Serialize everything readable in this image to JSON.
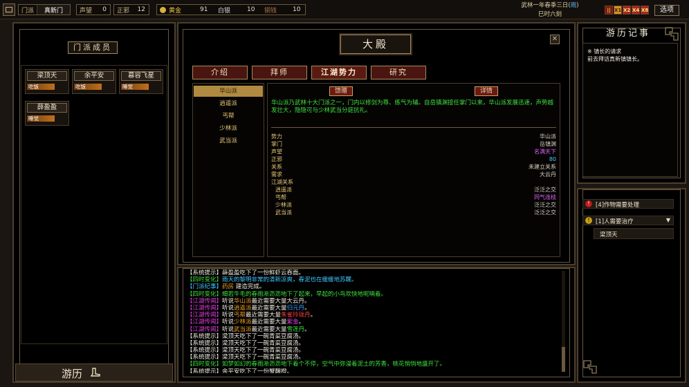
{
  "topbar": {
    "sect_label": "门派",
    "sect_name": "真新门",
    "reputation_label": "声望",
    "reputation_value": "0",
    "alignment_label": "正邪",
    "alignment_value": "12",
    "gold_label": "黄金",
    "gold_value": "91",
    "silver_label": "白银",
    "silver_value": "10",
    "copper_label": "铜钱",
    "copper_value": "10",
    "date_line1": "武林一年春季三日",
    "weather": "雨",
    "date_line2": "巳时六刻",
    "speeds": [
      "||",
      "X1",
      "X2",
      "X4",
      "X8"
    ],
    "options_label": "选项"
  },
  "members_panel": {
    "title": "门派成员",
    "members": [
      {
        "name": "梁顶天",
        "status": "吃饭"
      },
      {
        "name": "余平安",
        "status": "吃饭"
      },
      {
        "name": "慕容飞星",
        "status": "睡觉"
      },
      {
        "name": "薛盈盈",
        "status": "睡觉"
      }
    ],
    "travel_label": "游历"
  },
  "main": {
    "title": "大殿",
    "tabs": [
      "介绍",
      "拜师",
      "江湖势力",
      "研究"
    ],
    "active_tab": 2,
    "sects": [
      "华山派",
      "逍遥派",
      "丐帮",
      "少林派",
      "武当派"
    ],
    "active_sect": 0,
    "gift_label": "馈赠",
    "detail_label": "详情",
    "description": "华山派乃武林十大门派之一，门内以修剑为尊、练气为辅。自岳镇渊接任掌门以来，华山派发展迅速，声势越发壮大，隐隐可与少林武当分庭抗礼。",
    "info": [
      {
        "key": "势力",
        "value": "华山派"
      },
      {
        "key": "掌门",
        "value": "岳镇渊"
      },
      {
        "key": "声望",
        "value": "名满天下",
        "color": "#e060ff"
      },
      {
        "key": "正邪",
        "value": "80",
        "color": "#50c8ff"
      },
      {
        "key": "关系",
        "value": "未建立关系"
      },
      {
        "key": "需求",
        "value": "大云丹"
      },
      {
        "key": "江湖关系",
        "value": ""
      }
    ],
    "relations": [
      {
        "key": "逍遥派",
        "value": "泛泛之交"
      },
      {
        "key": "丐帮",
        "value": "同气连枝",
        "color": "#e060ff"
      },
      {
        "key": "少林派",
        "value": "泛泛之交"
      },
      {
        "key": "武当派",
        "value": "泛泛之交"
      }
    ]
  },
  "log": [
    {
      "tag": "【系统提示】",
      "tag_color": "#f0ebe0",
      "parts": [
        {
          "t": "薛盈盈吃下了一份鲜虾云吞面。"
        }
      ]
    },
    {
      "tag": "【四时变化】",
      "tag_color": "#40e040",
      "parts": [
        {
          "t": "雨天的黎明非常的清新凉爽，春泥也在缓缓地苏醒。",
          "c": "#40c8ff"
        }
      ]
    },
    {
      "tag": "【门派纪事】",
      "tag_color": "#40c8ff",
      "parts": [
        {
          "t": "药房",
          "c": "#f0a020"
        },
        {
          "t": " 建造完成。"
        }
      ]
    },
    {
      "tag": "【四时变化】",
      "tag_color": "#40e040",
      "parts": [
        {
          "t": "细若牛毛的春雨淅沥沥地下了起来，早起的小鸟欢快地呢喃着。",
          "c": "#40e040"
        }
      ]
    },
    {
      "tag": "【江湖传闻】",
      "tag_color": "#e040e0",
      "parts": [
        {
          "t": "听说"
        },
        {
          "t": "华山派",
          "c": "#f0a020"
        },
        {
          "t": "最近需要大量大云丹。"
        }
      ]
    },
    {
      "tag": "【江湖传闻】",
      "tag_color": "#e040e0",
      "parts": [
        {
          "t": "听说"
        },
        {
          "t": "逍遥派",
          "c": "#f0a020"
        },
        {
          "t": "最近需要大量"
        },
        {
          "t": "归元丹",
          "c": "#40a0ff"
        },
        {
          "t": "。"
        }
      ]
    },
    {
      "tag": "【江湖传闻】",
      "tag_color": "#e040e0",
      "parts": [
        {
          "t": "听说"
        },
        {
          "t": "丐帮",
          "c": "#f0a020"
        },
        {
          "t": "最近需要大量"
        },
        {
          "t": "朱雀玲珑丹",
          "c": "#ff4040"
        },
        {
          "t": "。"
        }
      ]
    },
    {
      "tag": "【江湖传闻】",
      "tag_color": "#e040e0",
      "parts": [
        {
          "t": "听说"
        },
        {
          "t": "少林派",
          "c": "#f0a020"
        },
        {
          "t": "最近需要大量"
        },
        {
          "t": "紫金",
          "c": "#e040e0"
        },
        {
          "t": "。"
        }
      ]
    },
    {
      "tag": "【江湖传闻】",
      "tag_color": "#e040e0",
      "parts": [
        {
          "t": "听说"
        },
        {
          "t": "武当派",
          "c": "#f0a020"
        },
        {
          "t": "最近需要大量"
        },
        {
          "t": "雪莲丹",
          "c": "#40e040"
        },
        {
          "t": "。"
        }
      ]
    },
    {
      "tag": "【系统提示】",
      "tag_color": "#f0ebe0",
      "parts": [
        {
          "t": "梁顶天吃下了一碗青菜豆腐汤。"
        }
      ]
    },
    {
      "tag": "【系统提示】",
      "tag_color": "#f0ebe0",
      "parts": [
        {
          "t": "梁顶天吃下了一碗青菜豆腐汤。"
        }
      ]
    },
    {
      "tag": "【系统提示】",
      "tag_color": "#f0ebe0",
      "parts": [
        {
          "t": "梁顶天吃下了一碗青菜豆腐汤。"
        }
      ]
    },
    {
      "tag": "【系统提示】",
      "tag_color": "#f0ebe0",
      "parts": [
        {
          "t": "梁顶天吃下了一碗青菜豆腐汤。"
        }
      ]
    },
    {
      "tag": "【四时变化】",
      "tag_color": "#40e040",
      "parts": [
        {
          "t": "如梦如幻的春雨淅沥沥地下着个不停，空气中弥漫着泥土的芳香，桃花悄悄地盛开了。",
          "c": "#40e040"
        }
      ]
    },
    {
      "tag": "【系统提示】",
      "tag_color": "#f0ebe0",
      "parts": [
        {
          "t": "余平安吃下了一份蟹醸橙。"
        }
      ]
    }
  ],
  "journal": {
    "title": "游历记事",
    "entry_title": "※ 镇长的请求",
    "entry_text": "前去拜访真新镇镇长。"
  },
  "alerts": [
    {
      "text": "[4]作物需要处理"
    },
    {
      "text": "[1]人需要治疗",
      "expanded": true,
      "children": [
        "梁顶天"
      ]
    }
  ]
}
